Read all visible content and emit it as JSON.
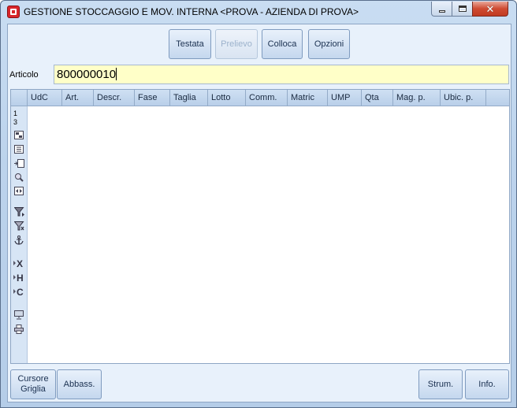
{
  "window": {
    "title": "GESTIONE STOCCAGGIO E MOV. INTERNA <PROVA - AZIENDA DI PROVA>"
  },
  "toolbar": {
    "testata": "Testata",
    "prelievo": "Prelievo",
    "colloca": "Colloca",
    "opzioni": "Opzioni"
  },
  "articolo": {
    "label": "Articolo",
    "value": "800000010"
  },
  "grid": {
    "columns": [
      "UdC",
      "Art.",
      "Descr.",
      "Fase",
      "Taglia",
      "Lotto",
      "Comm.",
      "Matric",
      "UMP",
      "Qta",
      "Mag. p.",
      "Ubic. p."
    ],
    "row_counter": [
      "1",
      "3"
    ],
    "row_header_icons": [
      "select-all-icon",
      "list-icon",
      "insert-row-icon",
      "zoom-icon",
      "fit-columns-icon",
      "filter-icon",
      "clear-filter-icon",
      "anchor-icon",
      "export-x-icon",
      "export-h-icon",
      "export-c-icon",
      "monitor-icon",
      "print-icon"
    ]
  },
  "footer": {
    "cursore": "Cursore Griglia",
    "abbass": "Abbass.",
    "strum": "Strum.",
    "info": "Info."
  }
}
